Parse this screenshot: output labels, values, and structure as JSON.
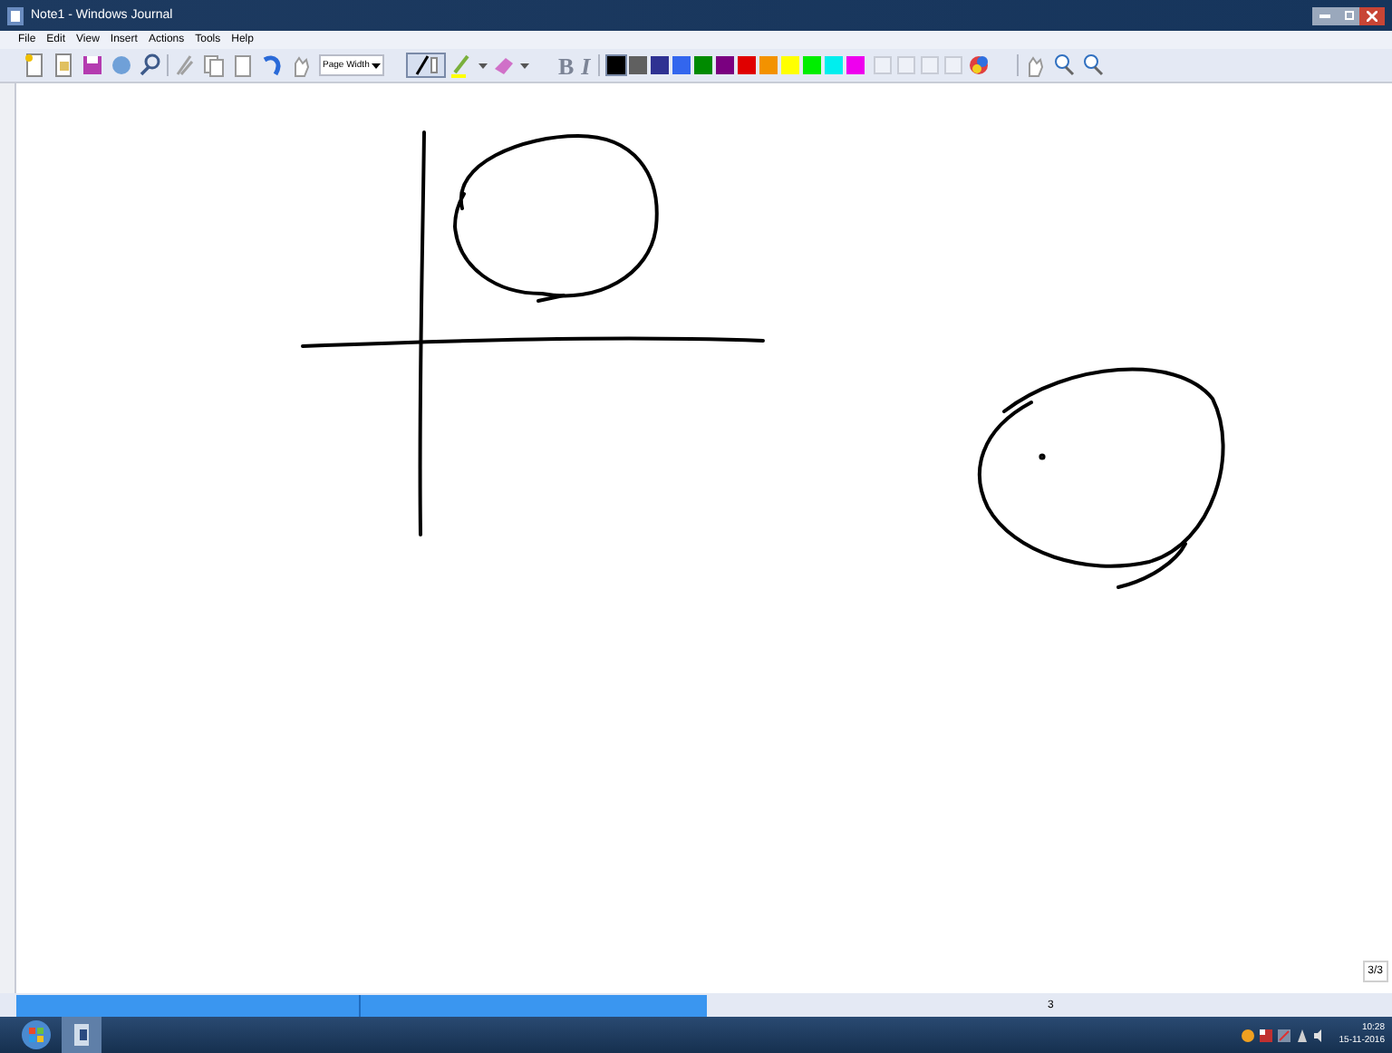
{
  "window": {
    "title": "Note1 - Windows Journal"
  },
  "menu": [
    "File",
    "Edit",
    "View",
    "Insert",
    "Actions",
    "Tools",
    "Help"
  ],
  "toolbar": {
    "zoom": "Page Width",
    "bold": "B",
    "italic": "I",
    "colors": [
      {
        "color": "#000000",
        "selected": true
      },
      {
        "color": "#606060",
        "selected": false
      },
      {
        "color": "#2e3192",
        "selected": false
      },
      {
        "color": "#3366ee",
        "selected": false
      },
      {
        "color": "#008a00",
        "selected": false
      },
      {
        "color": "#7a0080",
        "selected": false
      },
      {
        "color": "#e00000",
        "selected": false
      },
      {
        "color": "#f39200",
        "selected": false
      },
      {
        "color": "#ffff00",
        "selected": false
      },
      {
        "color": "#00ee00",
        "selected": false
      },
      {
        "color": "#00eeee",
        "selected": false
      },
      {
        "color": "#ee00ee",
        "selected": false
      }
    ]
  },
  "page_indicator": "3/3",
  "status_bar": {
    "text": "3"
  },
  "taskbar": {
    "time": "10:28",
    "date": "15-11-2016"
  }
}
